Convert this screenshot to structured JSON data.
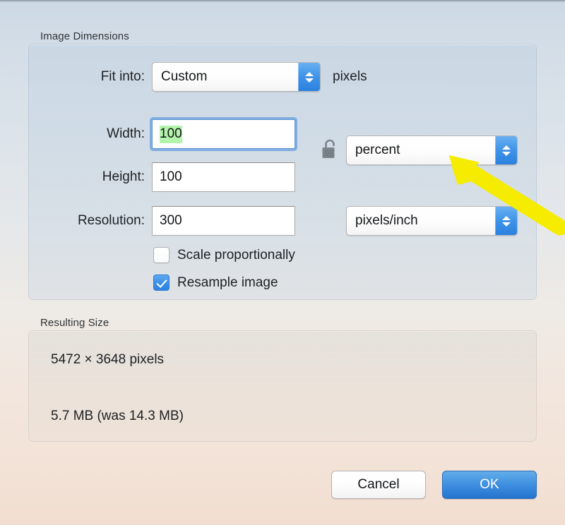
{
  "dialog": {
    "groups": {
      "image_dimensions_label": "Image Dimensions",
      "resulting_size_label": "Resulting Size"
    },
    "fit_into": {
      "label": "Fit into:",
      "value": "Custom",
      "unit_suffix": "pixels"
    },
    "width": {
      "label": "Width:",
      "value": "100",
      "focused": true,
      "selected": true
    },
    "height": {
      "label": "Height:",
      "value": "100"
    },
    "resolution": {
      "label": "Resolution:",
      "value": "300"
    },
    "units": {
      "dimension_unit": "percent",
      "resolution_unit": "pixels/inch"
    },
    "lock": {
      "state": "unlocked",
      "icon": "open-padlock-icon"
    },
    "options": [
      {
        "label": "Scale proportionally",
        "checked": false
      },
      {
        "label": "Resample image",
        "checked": true
      }
    ],
    "resulting_size": {
      "pixels": "5472 × 3648 pixels",
      "file_size": "5.7 MB (was 14.3 MB)"
    },
    "buttons": {
      "cancel": "Cancel",
      "ok": "OK"
    },
    "annotation": {
      "type": "arrow",
      "color": "#f5ec00",
      "points_at": "percent"
    },
    "colors": {
      "accent_blue": "#3f90e0",
      "selection_green": "#b3f3ac",
      "focus_ring": "#6aa2e0",
      "annotation_yellow": "#f5ec00"
    }
  }
}
